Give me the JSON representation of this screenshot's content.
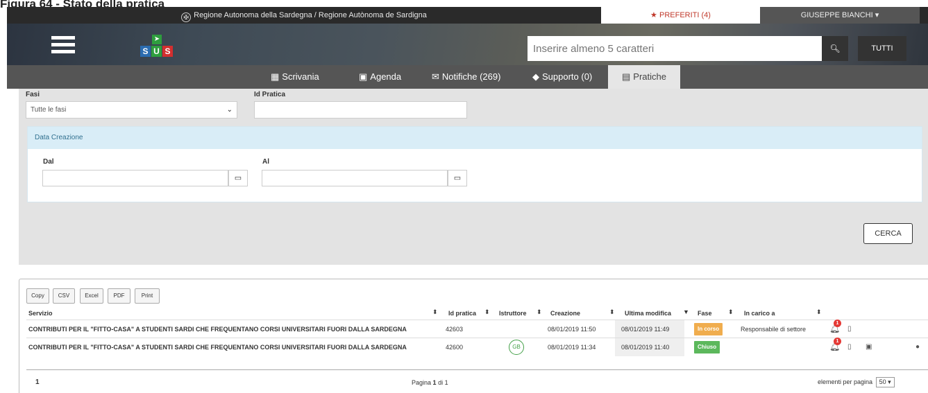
{
  "caption": "Figura 64 - Stato della pratica",
  "topbar": {
    "region": "Regione Autonoma della Sardegna / Regione Autònoma de Sardigna",
    "favorites": "PREFERITI (4)",
    "user": "GIUSEPPE BIANCHI"
  },
  "logo": {
    "letters": [
      "S",
      "U",
      "S"
    ]
  },
  "search": {
    "placeholder": "Inserire almeno 5 caratteri",
    "scope_label": "TUTTI"
  },
  "nav": {
    "scrivania": "Scrivania",
    "agenda": "Agenda",
    "notifiche": "Notifiche (269)",
    "supporto": "Supporto (0)",
    "pratiche": "Pratiche"
  },
  "filters": {
    "fasi_label": "Fasi",
    "fasi_value": "Tutte le fasi",
    "id_pratica_label": "Id Pratica",
    "data_creazione_label": "Data Creazione",
    "dal_label": "Dal",
    "al_label": "Al",
    "search_button": "CERCA"
  },
  "export": {
    "copy": "Copy",
    "csv": "CSV",
    "excel": "Excel",
    "pdf": "PDF",
    "print": "Print"
  },
  "table": {
    "headers": {
      "servizio": "Servizio",
      "id_pratica": "Id pratica",
      "istruttore": "Istruttore",
      "creazione": "Creazione",
      "ultima_modifica": "Ultima modifica",
      "fase": "Fase",
      "in_carico": "In carico a"
    },
    "rows": [
      {
        "servizio": "CONTRIBUTI PER IL \"FITTO-CASA\" A STUDENTI SARDI CHE FREQUENTANO CORSI UNIVERSITARI FUORI DALLA SARDEGNA",
        "id": "42603",
        "istruttore": "",
        "creazione": "08/01/2019 11:50",
        "ultima_modifica": "08/01/2019 11:49",
        "fase": "In corso",
        "in_carico": "Responsabile di settore",
        "notifications": "1"
      },
      {
        "servizio": "CONTRIBUTI PER IL \"FITTO-CASA\" A STUDENTI SARDI CHE FREQUENTANO CORSI UNIVERSITARI FUORI DALLA SARDEGNA",
        "id": "42600",
        "istruttore": "GB",
        "creazione": "08/01/2019 11:34",
        "ultima_modifica": "08/01/2019 11:40",
        "fase": "Chiuso",
        "in_carico": "",
        "notifications": "1"
      }
    ]
  },
  "pagination": {
    "current_page": "1",
    "info_prefix": "Pagina",
    "info_page": "1",
    "info_suffix": "di 1",
    "per_page_label": "elementi per pagina",
    "per_page_value": "50"
  },
  "colors": {
    "in_corso": "#f0ad4e",
    "chiuso": "#5cb85c",
    "accent_red": "#c0392b",
    "nav_bg": "#555555"
  }
}
